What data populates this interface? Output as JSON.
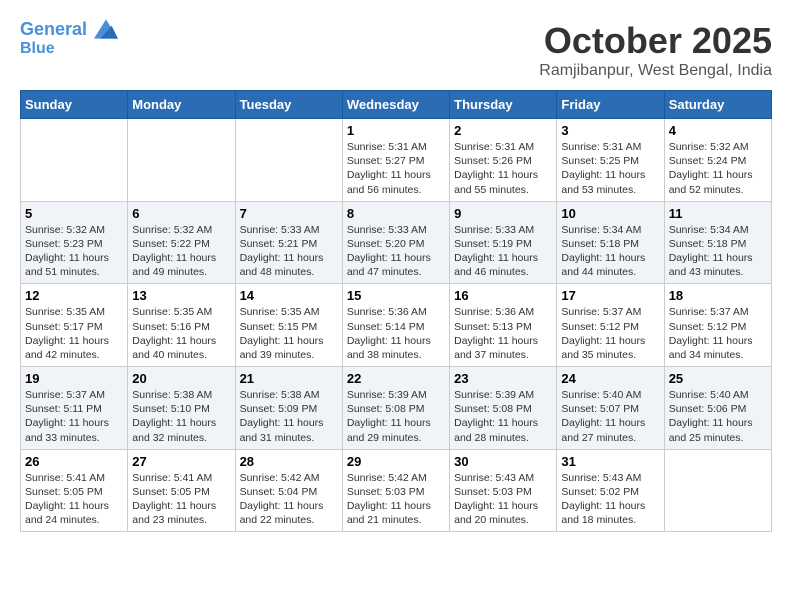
{
  "header": {
    "logo_line1": "General",
    "logo_line2": "Blue",
    "month": "October 2025",
    "location": "Ramjibanpur, West Bengal, India"
  },
  "days_of_week": [
    "Sunday",
    "Monday",
    "Tuesday",
    "Wednesday",
    "Thursday",
    "Friday",
    "Saturday"
  ],
  "weeks": [
    [
      {
        "day": "",
        "info": ""
      },
      {
        "day": "",
        "info": ""
      },
      {
        "day": "",
        "info": ""
      },
      {
        "day": "1",
        "info": "Sunrise: 5:31 AM\nSunset: 5:27 PM\nDaylight: 11 hours\nand 56 minutes."
      },
      {
        "day": "2",
        "info": "Sunrise: 5:31 AM\nSunset: 5:26 PM\nDaylight: 11 hours\nand 55 minutes."
      },
      {
        "day": "3",
        "info": "Sunrise: 5:31 AM\nSunset: 5:25 PM\nDaylight: 11 hours\nand 53 minutes."
      },
      {
        "day": "4",
        "info": "Sunrise: 5:32 AM\nSunset: 5:24 PM\nDaylight: 11 hours\nand 52 minutes."
      }
    ],
    [
      {
        "day": "5",
        "info": "Sunrise: 5:32 AM\nSunset: 5:23 PM\nDaylight: 11 hours\nand 51 minutes."
      },
      {
        "day": "6",
        "info": "Sunrise: 5:32 AM\nSunset: 5:22 PM\nDaylight: 11 hours\nand 49 minutes."
      },
      {
        "day": "7",
        "info": "Sunrise: 5:33 AM\nSunset: 5:21 PM\nDaylight: 11 hours\nand 48 minutes."
      },
      {
        "day": "8",
        "info": "Sunrise: 5:33 AM\nSunset: 5:20 PM\nDaylight: 11 hours\nand 47 minutes."
      },
      {
        "day": "9",
        "info": "Sunrise: 5:33 AM\nSunset: 5:19 PM\nDaylight: 11 hours\nand 46 minutes."
      },
      {
        "day": "10",
        "info": "Sunrise: 5:34 AM\nSunset: 5:18 PM\nDaylight: 11 hours\nand 44 minutes."
      },
      {
        "day": "11",
        "info": "Sunrise: 5:34 AM\nSunset: 5:18 PM\nDaylight: 11 hours\nand 43 minutes."
      }
    ],
    [
      {
        "day": "12",
        "info": "Sunrise: 5:35 AM\nSunset: 5:17 PM\nDaylight: 11 hours\nand 42 minutes."
      },
      {
        "day": "13",
        "info": "Sunrise: 5:35 AM\nSunset: 5:16 PM\nDaylight: 11 hours\nand 40 minutes."
      },
      {
        "day": "14",
        "info": "Sunrise: 5:35 AM\nSunset: 5:15 PM\nDaylight: 11 hours\nand 39 minutes."
      },
      {
        "day": "15",
        "info": "Sunrise: 5:36 AM\nSunset: 5:14 PM\nDaylight: 11 hours\nand 38 minutes."
      },
      {
        "day": "16",
        "info": "Sunrise: 5:36 AM\nSunset: 5:13 PM\nDaylight: 11 hours\nand 37 minutes."
      },
      {
        "day": "17",
        "info": "Sunrise: 5:37 AM\nSunset: 5:12 PM\nDaylight: 11 hours\nand 35 minutes."
      },
      {
        "day": "18",
        "info": "Sunrise: 5:37 AM\nSunset: 5:12 PM\nDaylight: 11 hours\nand 34 minutes."
      }
    ],
    [
      {
        "day": "19",
        "info": "Sunrise: 5:37 AM\nSunset: 5:11 PM\nDaylight: 11 hours\nand 33 minutes."
      },
      {
        "day": "20",
        "info": "Sunrise: 5:38 AM\nSunset: 5:10 PM\nDaylight: 11 hours\nand 32 minutes."
      },
      {
        "day": "21",
        "info": "Sunrise: 5:38 AM\nSunset: 5:09 PM\nDaylight: 11 hours\nand 31 minutes."
      },
      {
        "day": "22",
        "info": "Sunrise: 5:39 AM\nSunset: 5:08 PM\nDaylight: 11 hours\nand 29 minutes."
      },
      {
        "day": "23",
        "info": "Sunrise: 5:39 AM\nSunset: 5:08 PM\nDaylight: 11 hours\nand 28 minutes."
      },
      {
        "day": "24",
        "info": "Sunrise: 5:40 AM\nSunset: 5:07 PM\nDaylight: 11 hours\nand 27 minutes."
      },
      {
        "day": "25",
        "info": "Sunrise: 5:40 AM\nSunset: 5:06 PM\nDaylight: 11 hours\nand 25 minutes."
      }
    ],
    [
      {
        "day": "26",
        "info": "Sunrise: 5:41 AM\nSunset: 5:05 PM\nDaylight: 11 hours\nand 24 minutes."
      },
      {
        "day": "27",
        "info": "Sunrise: 5:41 AM\nSunset: 5:05 PM\nDaylight: 11 hours\nand 23 minutes."
      },
      {
        "day": "28",
        "info": "Sunrise: 5:42 AM\nSunset: 5:04 PM\nDaylight: 11 hours\nand 22 minutes."
      },
      {
        "day": "29",
        "info": "Sunrise: 5:42 AM\nSunset: 5:03 PM\nDaylight: 11 hours\nand 21 minutes."
      },
      {
        "day": "30",
        "info": "Sunrise: 5:43 AM\nSunset: 5:03 PM\nDaylight: 11 hours\nand 20 minutes."
      },
      {
        "day": "31",
        "info": "Sunrise: 5:43 AM\nSunset: 5:02 PM\nDaylight: 11 hours\nand 18 minutes."
      },
      {
        "day": "",
        "info": ""
      }
    ]
  ]
}
